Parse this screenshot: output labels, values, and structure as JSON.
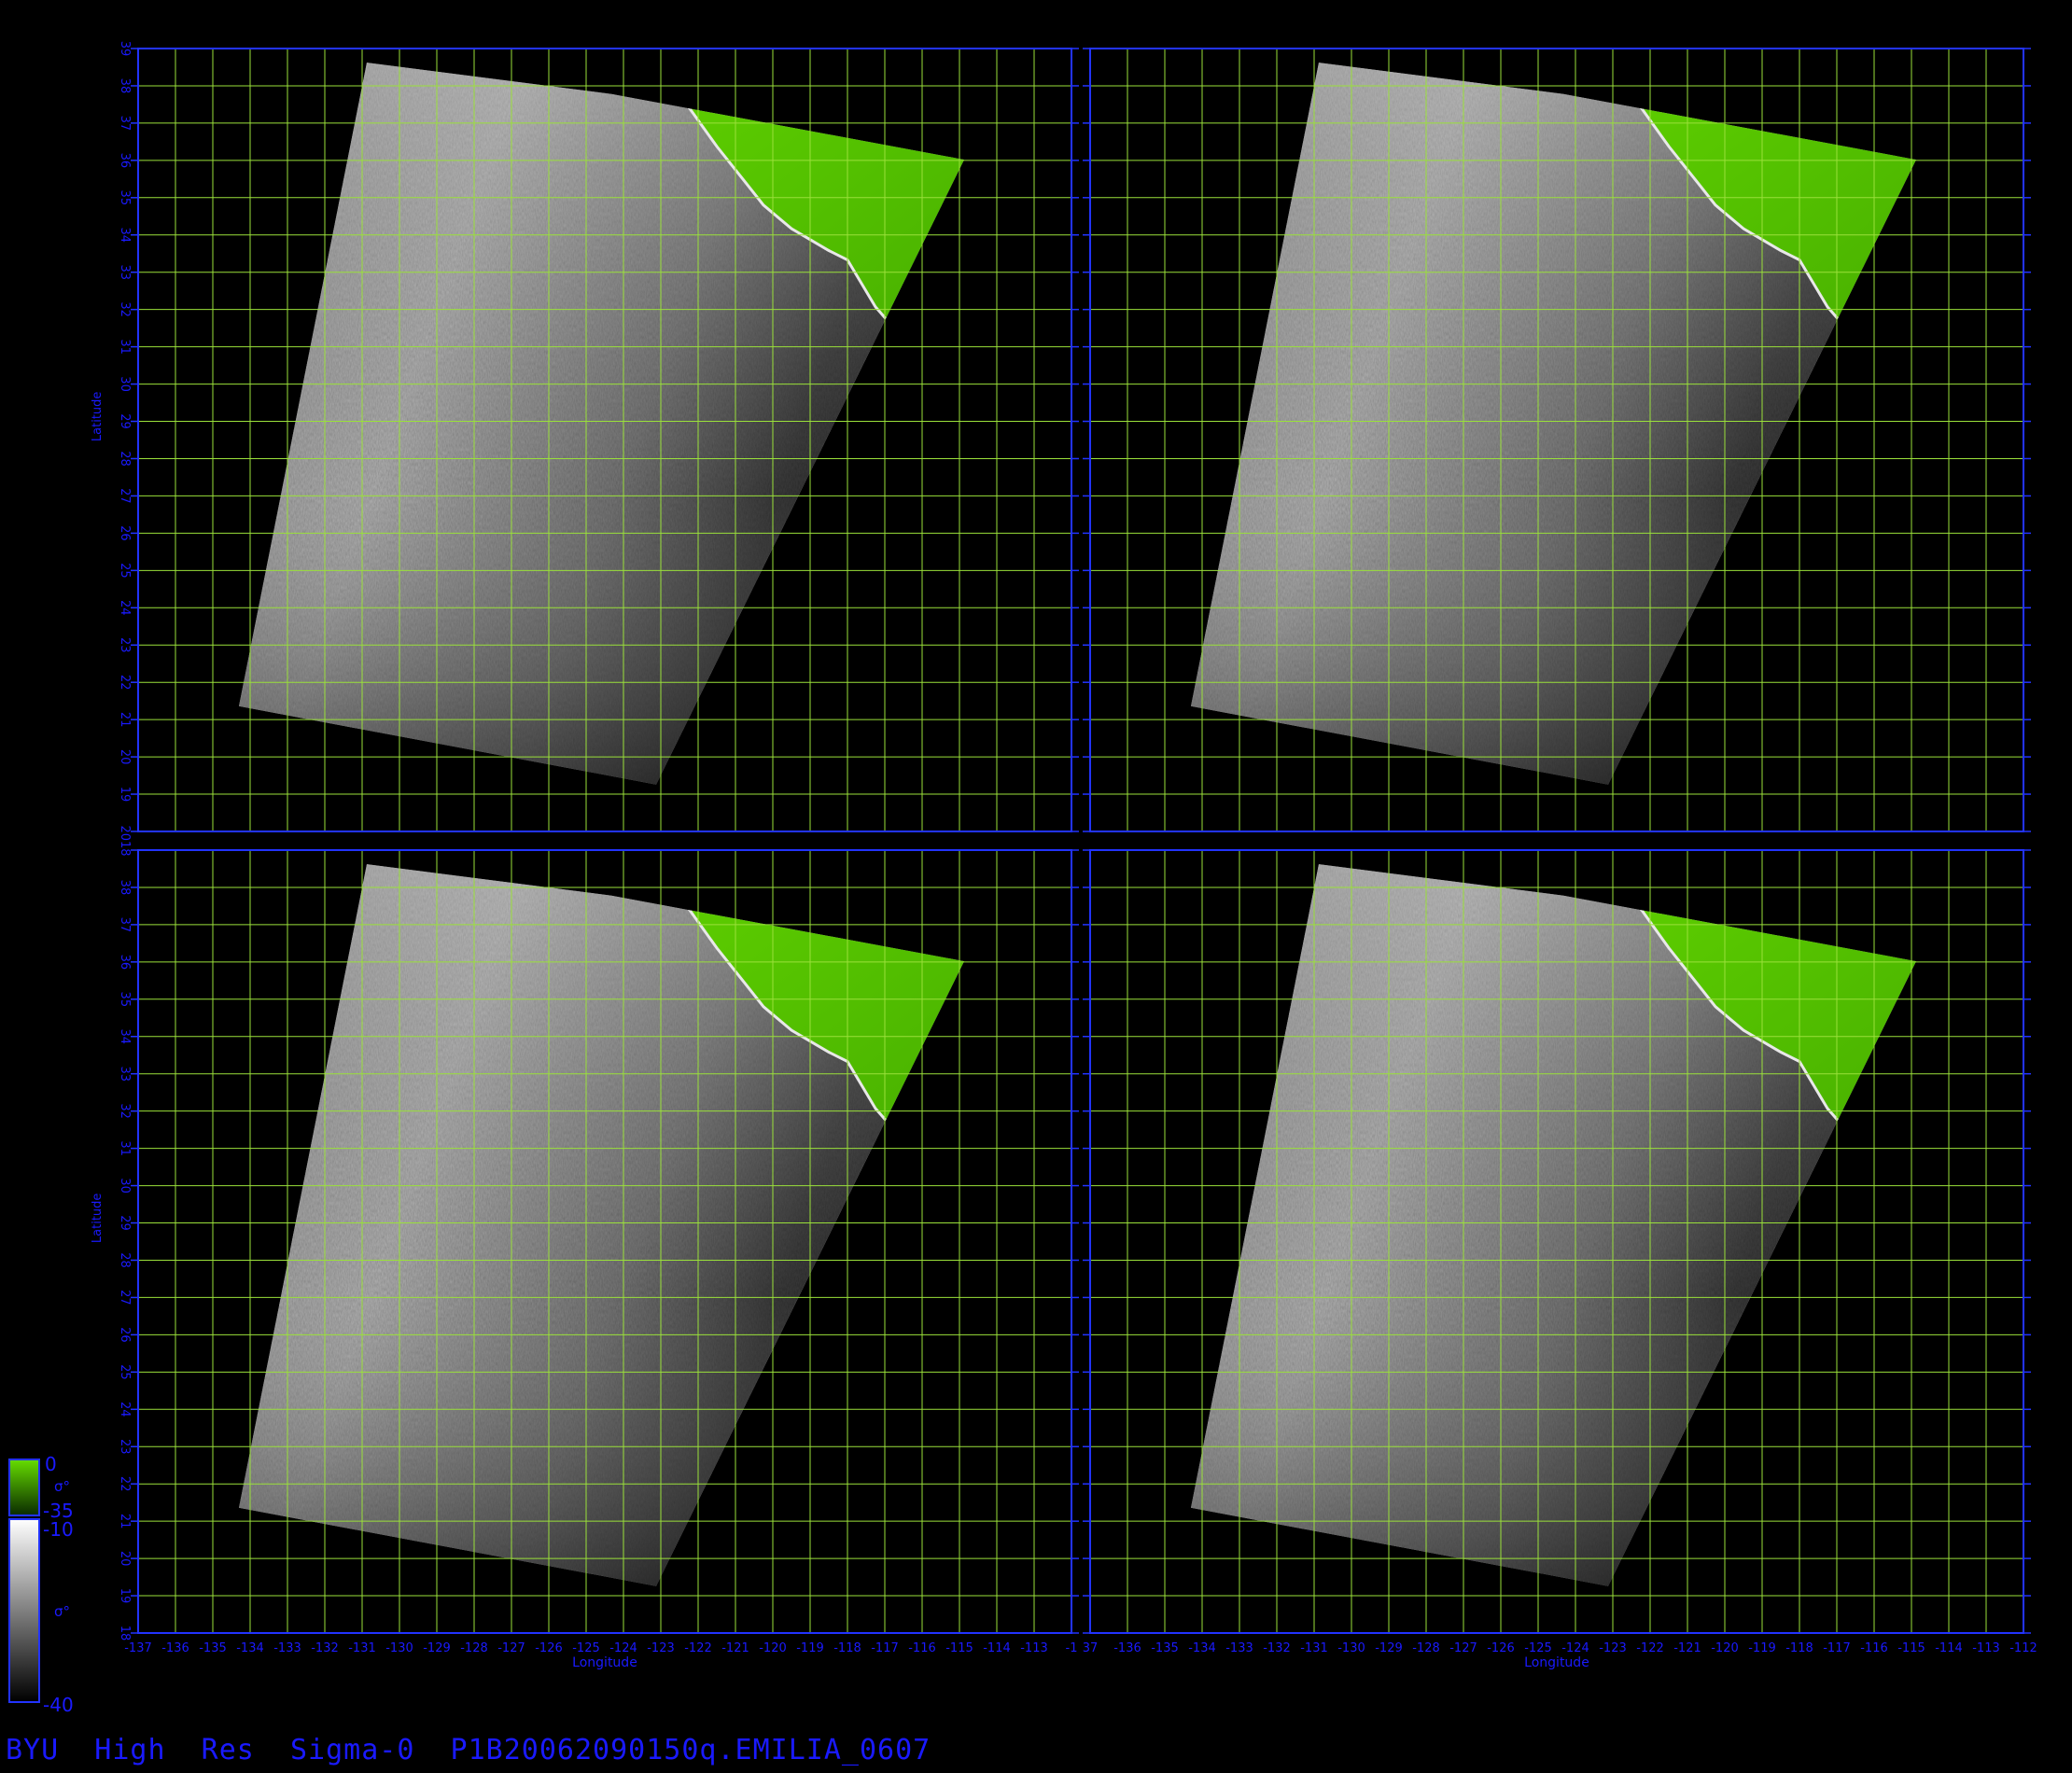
{
  "footer": {
    "title": "BYU  High  Res  Sigma-0  P1B20062090150q.EMILIA_0607"
  },
  "axes": {
    "xlabel": "Longitude",
    "ylabel": "Latitude",
    "lat_ticks": [
      "19",
      "20",
      "21",
      "22",
      "23",
      "24",
      "25",
      "26",
      "27",
      "28",
      "29",
      "30",
      "31",
      "32",
      "33",
      "34",
      "35",
      "36",
      "37",
      "38"
    ],
    "lat_corner_top": "39",
    "lat_corner_bottom": "18",
    "lat_corner_shared": "2018",
    "lon_ticks_left": [
      "-137",
      "-136",
      "-135",
      "-134",
      "-133",
      "-132",
      "-131",
      "-130",
      "-129",
      "-128",
      "-127",
      "-126",
      "-125",
      "-124",
      "-123",
      "-122",
      "-121",
      "-120",
      "-119",
      "-118",
      "-117",
      "-116",
      "-115",
      "-114",
      "-113",
      "-112"
    ],
    "lon_ticks_right": [
      "37",
      "-136",
      "-135",
      "-134",
      "-133",
      "-132",
      "-131",
      "-130",
      "-129",
      "-128",
      "-127",
      "-126",
      "-125",
      "-124",
      "-123",
      "-122",
      "-121",
      "-120",
      "-119",
      "-118",
      "-117",
      "-116",
      "-115",
      "-114",
      "-113",
      "-112"
    ],
    "lon_join_label": "-1",
    "lon_range": [
      -137,
      -112
    ],
    "lat_range": [
      18,
      39
    ]
  },
  "colorbar": {
    "green_top": "0",
    "green_bottom": "-35",
    "gray_top": "-10",
    "gray_bottom": "-40",
    "symbol": "σ°"
  },
  "colors": {
    "frame": "#2233ff",
    "grid": "#9ae03a",
    "land": "#55c800",
    "axis_text": "#1a1aff"
  },
  "panels": [
    {
      "id": "top-left",
      "swath": "ocean backscatter swath with green land mask (Baja California / Mexico)"
    },
    {
      "id": "top-right",
      "swath": "ocean backscatter swath with green land mask (Baja California / Mexico)"
    },
    {
      "id": "bottom-left",
      "swath": "ocean backscatter swath with green land mask (Baja California / Mexico)"
    },
    {
      "id": "bottom-right",
      "swath": "ocean backscatter swath with green land mask (Baja California / Mexico)"
    }
  ]
}
